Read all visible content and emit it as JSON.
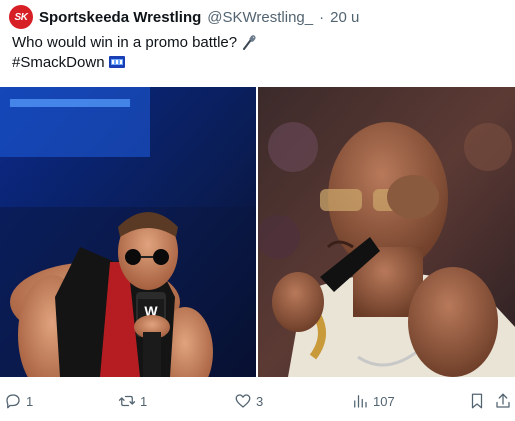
{
  "tweet": {
    "avatar_text": "SK",
    "display_name": "Sportskeeda Wrestling",
    "handle": "@SKWrestling_",
    "separator": "·",
    "time": "20 u",
    "text_line1": "Who would win in a promo battle?",
    "hashtag": "#SmackDown",
    "icons": [
      "microphone-emoji",
      "smackdown-hashflag"
    ]
  },
  "media": {
    "count": 2,
    "brand_logo": "W"
  },
  "actions": {
    "replies": "1",
    "reposts": "1",
    "likes": "3",
    "views": "107",
    "icons": [
      "reply-icon",
      "repost-icon",
      "like-icon",
      "views-icon",
      "bookmark-icon",
      "share-icon"
    ]
  },
  "colors": {
    "text": "#0f1419",
    "muted": "#536471",
    "brand": "#d71f26",
    "link": "#1d9bf0"
  }
}
